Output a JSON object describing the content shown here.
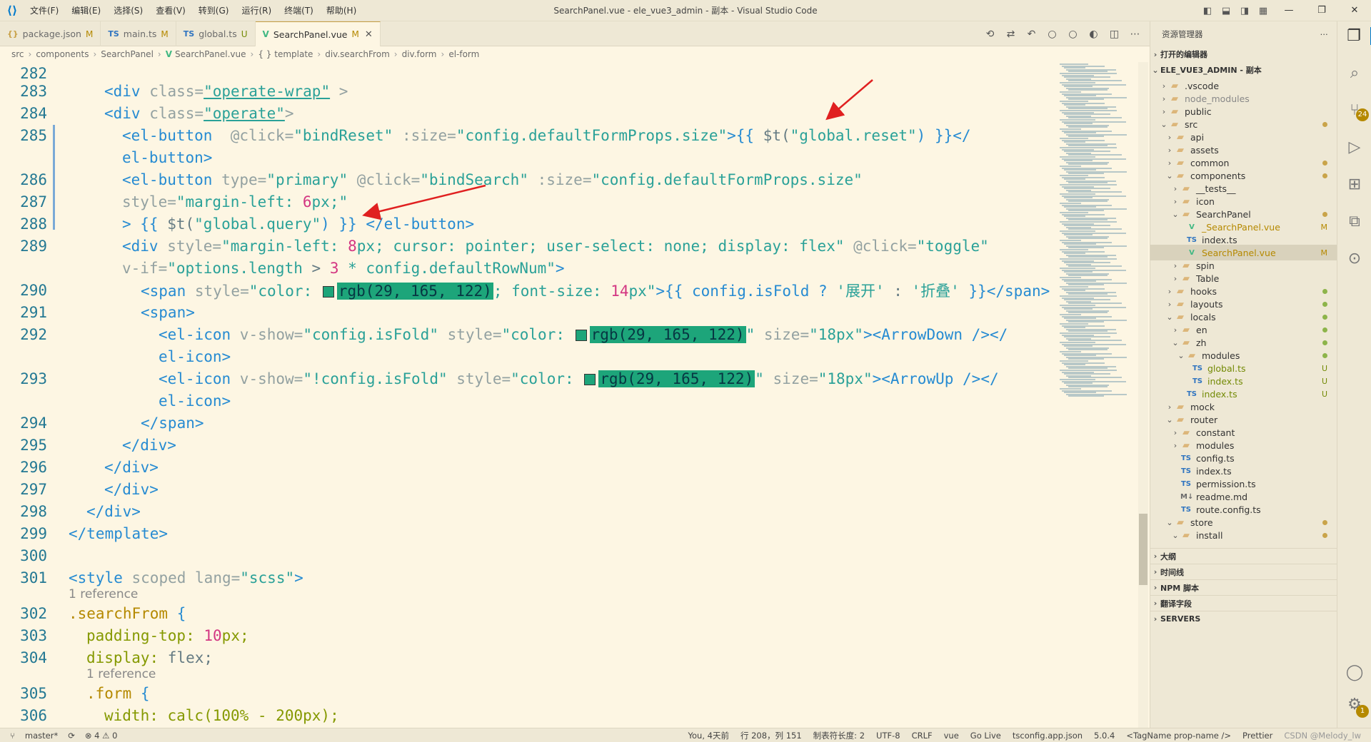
{
  "titlebar": {
    "menu": [
      "文件(F)",
      "编辑(E)",
      "选择(S)",
      "查看(V)",
      "转到(G)",
      "运行(R)",
      "终端(T)",
      "帮助(H)"
    ],
    "title": "SearchPanel.vue - ele_vue3_admin - 副本 - Visual Studio Code"
  },
  "tabs": [
    {
      "icon": "{}",
      "label": "package.json",
      "status": "M"
    },
    {
      "icon": "TS",
      "label": "main.ts",
      "status": "M"
    },
    {
      "icon": "TS",
      "label": "global.ts",
      "status": "U"
    },
    {
      "icon": "V",
      "label": "SearchPanel.vue",
      "status": "M"
    }
  ],
  "breadcrumb": [
    "src",
    "components",
    "SearchPanel",
    "SearchPanel.vue",
    "{ } template",
    "div.searchFrom",
    "div.form",
    "el-form"
  ],
  "gutter": [
    "282",
    "283",
    "284",
    "285",
    "286",
    "287",
    "288",
    "289",
    "290",
    "291",
    "292",
    "293",
    "294",
    "295",
    "296",
    "297",
    "298",
    "299",
    "300",
    "301",
    "302",
    "303",
    "304",
    "305",
    "306"
  ],
  "code": {
    "l283a": "<div ",
    "l283b": "class=",
    "l283c": "\"operate-wrap\"",
    "l283d": " >",
    "l284a": "<div ",
    "l284b": "class=",
    "l284c": "\"operate\"",
    "l284d": ">",
    "l285a": "<el-button ",
    "l285b": " @click=",
    "l285c": "\"bindReset\"",
    "l285d": " :size=",
    "l285e": "\"config.defaultFormProps.size\"",
    "l285f": ">{{ ",
    "l285g": "$t(",
    "l285h": "\"global.reset\"",
    "l285i": ") }}</",
    "l285w": "el-button>",
    "l286a": "<el-button ",
    "l286b": "type=",
    "l286c": "\"primary\"",
    "l286d": " @click=",
    "l286e": "\"bindSearch\"",
    "l286f": " :size=",
    "l286g": "\"config.defaultFormProps.size\"",
    "l287a": "style=",
    "l287b": "\"margin-left: ",
    "l287c": "6",
    "l287d": "px;\"",
    "l288a": "> {{ ",
    "l288b": "$t(",
    "l288c": "\"global.query\"",
    "l288d": ") }} ",
    "l288e": "</el-button>",
    "l289a": "<div ",
    "l289b": "style=",
    "l289c": "\"margin-left: ",
    "l289d": "8",
    "l289e": "px; cursor: pointer; user-select: none; display: flex\"",
    "l289f": " @click=",
    "l289g": "\"toggle\"",
    "l289w1": "v-if=",
    "l289w2": "\"options.length ",
    "l289w3": "> ",
    "l289w4": "3",
    "l289w5": " * config.defaultRowNum\"",
    "l289w6": ">",
    "l290a": "<span ",
    "l290b": "style=",
    "l290c": "\"color: ",
    "l290d": "rgb(29, 165, 122)",
    "l290e": "; font-size: ",
    "l290f": "14",
    "l290g": "px\"",
    "l290h": ">{{ config.isFold ? ",
    "l290i": "'展开'",
    "l290j": " : ",
    "l290k": "'折叠'",
    "l290l": " }}</span>",
    "l291a": "<span>",
    "l292a": "<el-icon ",
    "l292b": "v-show=",
    "l292c": "\"config.isFold\"",
    "l292d": " style=",
    "l292e": "\"color: ",
    "l292f": "rgb(29, 165, 122)",
    "l292g": "\"",
    "l292h": " size=",
    "l292i": "\"18px\"",
    "l292j": "><ArrowDown ",
    "l292k": "/></",
    "l292w": "el-icon>",
    "l293a": "<el-icon ",
    "l293b": "v-show=",
    "l293c": "\"!config.isFold\"",
    "l293d": " style=",
    "l293e": "\"color: ",
    "l293f": "rgb(29, 165, 122)",
    "l293g": "\"",
    "l293h": " size=",
    "l293i": "\"18px\"",
    "l293j": "><ArrowUp ",
    "l293k": "/></",
    "l293w": "el-icon>",
    "l294a": "</span>",
    "l295a": "</div>",
    "l296a": "</div>",
    "l297a": "</div>",
    "l298a": "</div>",
    "l299a": "</template>",
    "l301a": "<style ",
    "l301b": "scoped ",
    "l301c": "lang=",
    "l301d": "\"scss\"",
    "l301e": ">",
    "ref1": "1 reference",
    "l302a": ".searchFrom ",
    "l302b": "{",
    "l303a": "padding-top: ",
    "l303b": "10",
    "l303c": "px;",
    "l304a": "display: ",
    "l304b": "flex;",
    "ref2": "1 reference",
    "l305a": ".form ",
    "l305b": "{",
    "l306a": "width: calc(100% - 200px);"
  },
  "explorer": {
    "title": "资源管理器",
    "open_editors": "打开的编辑器",
    "project": "ELE_VUE3_ADMIN - 副本",
    "items": [
      {
        "label": ".vscode",
        "kind": "folder",
        "status": ""
      },
      {
        "label": "node_modules",
        "kind": "folder",
        "status": ""
      },
      {
        "label": "public",
        "kind": "folder",
        "status": ""
      },
      {
        "label": "src",
        "kind": "folder",
        "status": "dot-y"
      },
      {
        "label": "api",
        "kind": "folder",
        "status": ""
      },
      {
        "label": "assets",
        "kind": "folder",
        "status": ""
      },
      {
        "label": "common",
        "kind": "folder",
        "status": "dot-y"
      },
      {
        "label": "components",
        "kind": "folder",
        "status": "dot-y"
      },
      {
        "label": "__tests__",
        "kind": "folder",
        "status": ""
      },
      {
        "label": "icon",
        "kind": "folder",
        "status": ""
      },
      {
        "label": "SearchPanel",
        "kind": "folder",
        "status": "dot-y"
      },
      {
        "label": "_SearchPanel.vue",
        "kind": "vue",
        "status": "M"
      },
      {
        "label": "index.ts",
        "kind": "ts",
        "status": ""
      },
      {
        "label": "SearchPanel.vue",
        "kind": "vue",
        "status": "M"
      },
      {
        "label": "spin",
        "kind": "folder",
        "status": ""
      },
      {
        "label": "Table",
        "kind": "folder",
        "status": ""
      },
      {
        "label": "hooks",
        "kind": "folder",
        "status": "dot-g"
      },
      {
        "label": "layouts",
        "kind": "folder",
        "status": "dot-g"
      },
      {
        "label": "locals",
        "kind": "folder",
        "status": "dot-g"
      },
      {
        "label": "en",
        "kind": "folder",
        "status": "dot-g"
      },
      {
        "label": "zh",
        "kind": "folder",
        "status": "dot-g"
      },
      {
        "label": "modules",
        "kind": "folder",
        "status": "dot-g"
      },
      {
        "label": "global.ts",
        "kind": "ts",
        "status": "U"
      },
      {
        "label": "index.ts",
        "kind": "ts",
        "status": "U"
      },
      {
        "label": "index.ts",
        "kind": "ts",
        "status": "U"
      },
      {
        "label": "mock",
        "kind": "folder",
        "status": ""
      },
      {
        "label": "router",
        "kind": "folder",
        "status": ""
      },
      {
        "label": "constant",
        "kind": "folder",
        "status": ""
      },
      {
        "label": "modules",
        "kind": "folder",
        "status": ""
      },
      {
        "label": "config.ts",
        "kind": "ts",
        "status": ""
      },
      {
        "label": "index.ts",
        "kind": "ts",
        "status": ""
      },
      {
        "label": "permission.ts",
        "kind": "ts",
        "status": ""
      },
      {
        "label": "readme.md",
        "kind": "md",
        "status": ""
      },
      {
        "label": "route.config.ts",
        "kind": "ts",
        "status": ""
      },
      {
        "label": "store",
        "kind": "folder",
        "status": "dot-y"
      },
      {
        "label": "install",
        "kind": "folder",
        "status": "dot-y"
      }
    ],
    "sections": [
      "大纲",
      "时间线",
      "NPM 脚本",
      "翻译字段",
      "SERVERS"
    ]
  },
  "activity": {
    "badge": "24",
    "settings_badge": "1"
  },
  "statusbar": {
    "branch": "master*",
    "errors": "⊗ 4 ⚠ 0",
    "blame": "You, 4天前",
    "position": "行 208，列 151",
    "tab": "制表符长度: 2",
    "encoding": "UTF-8",
    "eol": "CRLF",
    "lang": "vue",
    "golive": "Go Live",
    "tsconfig": "tsconfig.app.json",
    "version": "5.0.4",
    "tagname": "<TagName prop-name />",
    "prettier": "Prettier",
    "watermark": "CSDN @Melody_lw"
  },
  "colors": {
    "swatch": "#1da57a",
    "tag": "#268bd2",
    "string": "#2aa198",
    "number": "#d33682"
  }
}
